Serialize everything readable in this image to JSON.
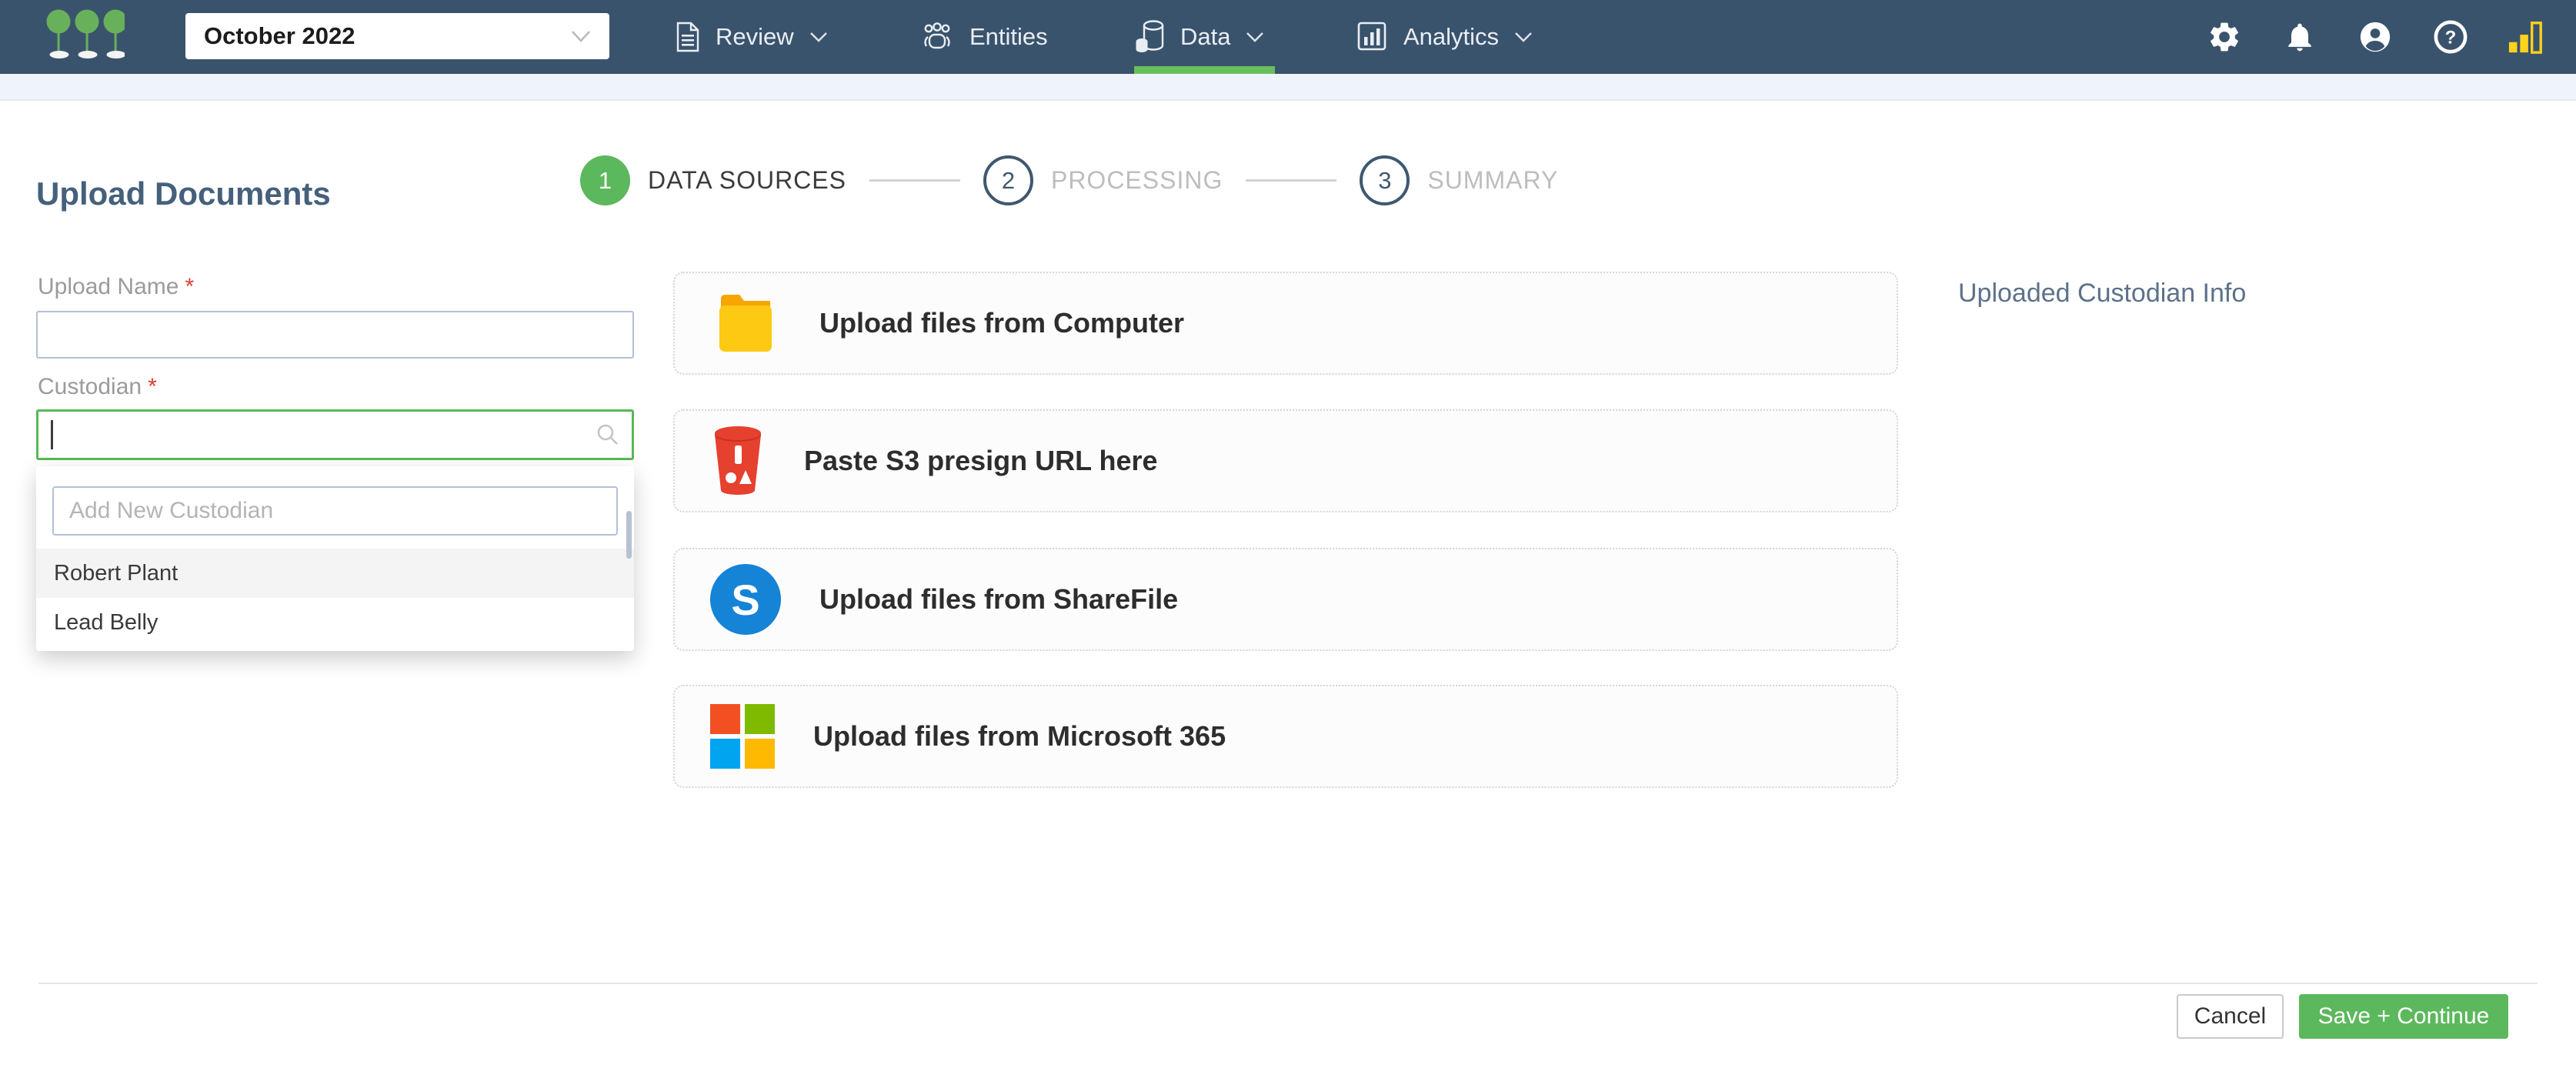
{
  "nav": {
    "project_selector": {
      "value": "October 2022"
    },
    "items": [
      {
        "label": "Review",
        "icon": "document-icon",
        "has_chevron": true,
        "active": false
      },
      {
        "label": "Entities",
        "icon": "people-icon",
        "has_chevron": false,
        "active": false
      },
      {
        "label": "Data",
        "icon": "database-icon",
        "has_chevron": true,
        "active": true
      },
      {
        "label": "Analytics",
        "icon": "bar-chart-icon",
        "has_chevron": true,
        "active": false
      }
    ],
    "right_icons": [
      "settings",
      "notifications",
      "account",
      "help",
      "connection-status"
    ]
  },
  "page": {
    "title": "Upload Documents",
    "steps": [
      {
        "number": "1",
        "label": "DATA SOURCES",
        "state": "active"
      },
      {
        "number": "2",
        "label": "PROCESSING",
        "state": "upcoming"
      },
      {
        "number": "3",
        "label": "SUMMARY",
        "state": "upcoming"
      }
    ]
  },
  "form": {
    "upload_name": {
      "label": "Upload Name",
      "required_marker": "*",
      "value": ""
    },
    "custodian": {
      "label": "Custodian",
      "required_marker": "*",
      "value": "",
      "dropdown": {
        "add_input_placeholder": "Add New Custodian",
        "options": [
          "Robert Plant",
          "Lead Belly"
        ],
        "highlighted": "Robert Plant"
      }
    }
  },
  "sources": [
    {
      "label": "Upload files from Computer",
      "icon": "folder-icon"
    },
    {
      "label": "Paste S3 presign URL here",
      "icon": "s3-bucket-icon"
    },
    {
      "label": "Upload files from ShareFile",
      "icon": "sharefile-icon",
      "glyph": "S"
    },
    {
      "label": "Upload files from Microsoft 365",
      "icon": "microsoft-icon"
    }
  ],
  "right_panel": {
    "title": "Uploaded Custodian Info"
  },
  "footer": {
    "cancel_label": "Cancel",
    "save_label": "Save + Continue"
  },
  "colors": {
    "navbar": "#3a536d",
    "accent_green": "#5cb85c",
    "underline_green": "#68bf5b",
    "logo_green": "#68b05a",
    "signal_yellow": "#ffd21c",
    "folder_yellow": "#fdc913",
    "folder_orange": "#f7a600",
    "s3_red": "#e6402f",
    "sharefile_blue": "#1583d6",
    "microsoft": [
      "#f25022",
      "#7fba00",
      "#00a4ef",
      "#ffb900"
    ]
  }
}
